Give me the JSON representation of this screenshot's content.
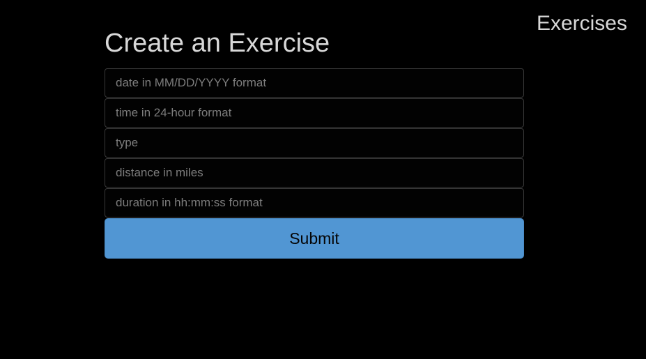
{
  "nav": {
    "exercises_link": "Exercises"
  },
  "form": {
    "title": "Create an Exercise",
    "fields": [
      {
        "placeholder": "date in MM/DD/YYYY format",
        "value": ""
      },
      {
        "placeholder": "time in 24-hour format",
        "value": ""
      },
      {
        "placeholder": "type",
        "value": ""
      },
      {
        "placeholder": "distance in miles",
        "value": ""
      },
      {
        "placeholder": "duration in hh:mm:ss format",
        "value": ""
      }
    ],
    "submit_label": "Submit"
  },
  "colors": {
    "background": "#000000",
    "text": "#d8d8d8",
    "accent": "#5196d3"
  }
}
